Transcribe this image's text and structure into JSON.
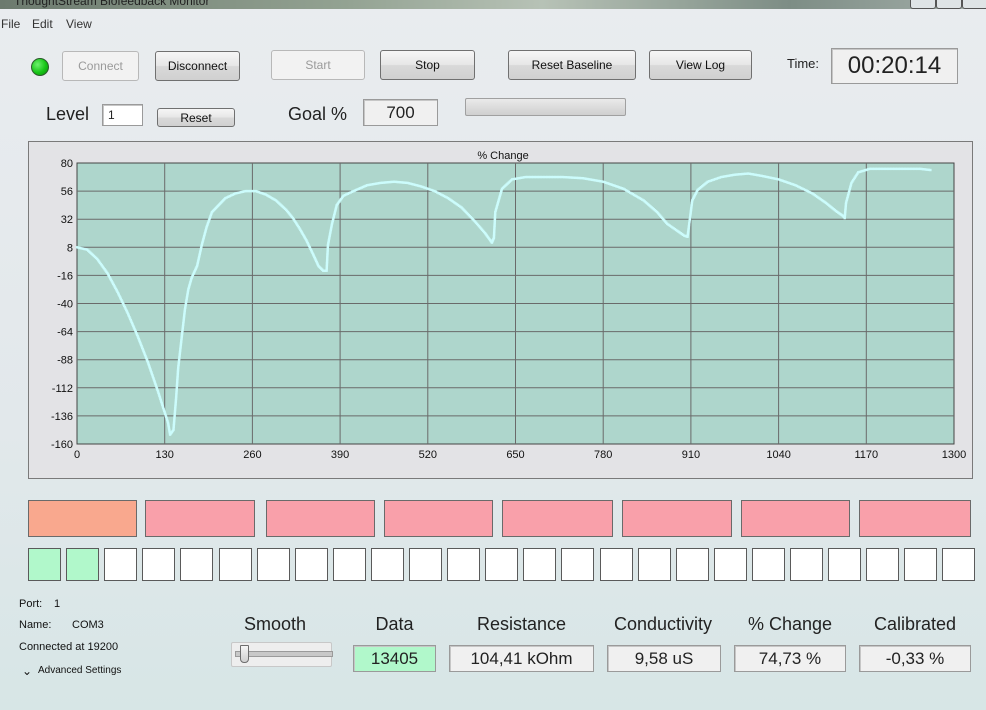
{
  "window": {
    "title": "ThoughtStream Biofeedback Monitor"
  },
  "menu": [
    "File",
    "Edit",
    "View"
  ],
  "toolbar": {
    "connect": "Connect",
    "disconnect": "Disconnect",
    "start": "Start",
    "stop": "Stop",
    "reset_baseline": "Reset Baseline",
    "view_log": "View Log",
    "time_label": "Time:",
    "time_value": "00:20:14"
  },
  "level": {
    "label": "Level",
    "value": "1",
    "reset": "Reset"
  },
  "goal": {
    "label": "Goal %",
    "value": "700",
    "progress": 0
  },
  "colors": {
    "chart_bg": "#aed6cc",
    "series": "#ccfcfc",
    "bar_active": "#f9a88e",
    "bar": "#f9a0aa",
    "square_active": "#b1f8cb",
    "data_box": "#b1f8cb",
    "led": "#16c416"
  },
  "chart_data": {
    "type": "scatter",
    "title": "% Change",
    "xlabel": "",
    "ylabel": "",
    "xlim": [
      0,
      1300
    ],
    "ylim": [
      -160,
      80
    ],
    "x_ticks": [
      0,
      130,
      260,
      390,
      520,
      650,
      780,
      910,
      1040,
      1170,
      1300
    ],
    "y_ticks": [
      80,
      56,
      32,
      8,
      -16,
      -40,
      -64,
      -88,
      -112,
      -136,
      -160
    ],
    "grid": true,
    "series": [
      {
        "points": [
          [
            0,
            8
          ],
          [
            15,
            6
          ],
          [
            30,
            -2
          ],
          [
            45,
            -14
          ],
          [
            60,
            -30
          ],
          [
            75,
            -48
          ],
          [
            90,
            -68
          ],
          [
            105,
            -90
          ],
          [
            120,
            -115
          ],
          [
            135,
            -142
          ],
          [
            138,
            -152
          ],
          [
            143,
            -148
          ],
          [
            147,
            -120
          ],
          [
            150,
            -95
          ],
          [
            155,
            -70
          ],
          [
            160,
            -45
          ],
          [
            165,
            -28
          ],
          [
            170,
            -18
          ],
          [
            178,
            -8
          ],
          [
            185,
            10
          ],
          [
            192,
            25
          ],
          [
            200,
            38
          ],
          [
            210,
            44
          ],
          [
            220,
            50
          ],
          [
            235,
            54
          ],
          [
            250,
            56
          ],
          [
            265,
            56
          ],
          [
            280,
            53
          ],
          [
            295,
            48
          ],
          [
            310,
            40
          ],
          [
            320,
            33
          ],
          [
            330,
            24
          ],
          [
            340,
            14
          ],
          [
            350,
            2
          ],
          [
            358,
            -8
          ],
          [
            365,
            -12
          ],
          [
            370,
            -12
          ],
          [
            372,
            10
          ],
          [
            378,
            28
          ],
          [
            385,
            44
          ],
          [
            395,
            52
          ],
          [
            410,
            56
          ],
          [
            430,
            61
          ],
          [
            450,
            63
          ],
          [
            470,
            64
          ],
          [
            490,
            63
          ],
          [
            510,
            60
          ],
          [
            530,
            56
          ],
          [
            550,
            50
          ],
          [
            570,
            42
          ],
          [
            590,
            30
          ],
          [
            605,
            20
          ],
          [
            615,
            12
          ],
          [
            618,
            16
          ],
          [
            620,
            38
          ],
          [
            630,
            58
          ],
          [
            645,
            66
          ],
          [
            665,
            68
          ],
          [
            690,
            68
          ],
          [
            720,
            68
          ],
          [
            750,
            67
          ],
          [
            780,
            64
          ],
          [
            810,
            58
          ],
          [
            840,
            48
          ],
          [
            860,
            38
          ],
          [
            875,
            28
          ],
          [
            890,
            22
          ],
          [
            900,
            18
          ],
          [
            905,
            17
          ],
          [
            908,
            30
          ],
          [
            912,
            48
          ],
          [
            920,
            57
          ],
          [
            935,
            64
          ],
          [
            955,
            68
          ],
          [
            975,
            70
          ],
          [
            995,
            71
          ],
          [
            1015,
            69
          ],
          [
            1040,
            66
          ],
          [
            1065,
            61
          ],
          [
            1090,
            54
          ],
          [
            1110,
            46
          ],
          [
            1125,
            39
          ],
          [
            1135,
            35
          ],
          [
            1138,
            33
          ],
          [
            1140,
            46
          ],
          [
            1148,
            63
          ],
          [
            1158,
            72
          ],
          [
            1175,
            75
          ],
          [
            1200,
            75
          ],
          [
            1225,
            75
          ],
          [
            1250,
            75
          ],
          [
            1265,
            74
          ]
        ]
      }
    ]
  },
  "bars": [
    {
      "active": true
    },
    {
      "active": false
    },
    {
      "active": false
    },
    {
      "active": false
    },
    {
      "active": false
    },
    {
      "active": false
    },
    {
      "active": false
    },
    {
      "active": false
    }
  ],
  "squares_active": 2,
  "squares_total": 25,
  "connection": {
    "port_label": "Port:",
    "port": "1",
    "name_label": "Name:",
    "name": "COM3",
    "status": "Connected at 19200",
    "advanced": "Advanced Settings"
  },
  "stats": {
    "smooth": {
      "label": "Smooth",
      "value": 0
    },
    "data": {
      "label": "Data",
      "value": "13405"
    },
    "resistance": {
      "label": "Resistance",
      "value": "104,41 kOhm"
    },
    "conductivity": {
      "label": "Conductivity",
      "value": "9,58 uS"
    },
    "pct_change": {
      "label": "% Change",
      "value": "74,73 %"
    },
    "calibrated": {
      "label": "Calibrated",
      "value": "-0,33 %"
    }
  }
}
